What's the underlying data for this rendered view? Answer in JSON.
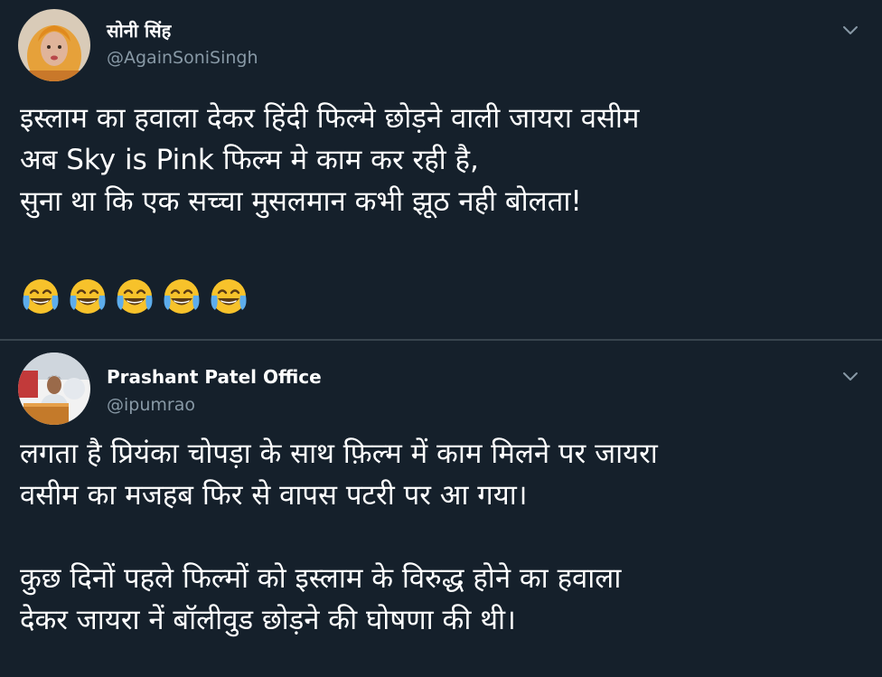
{
  "tweets": [
    {
      "display_name": "सोनी सिंह",
      "handle": "@AgainSoniSingh",
      "avatar": "avatar-woman-orange-scarf",
      "menu_icon": "chevron-down-icon",
      "text_lines": [
        "इस्लाम का हवाला देकर हिंदी फिल्मे छोड़ने वाली जायरा वसीम",
        "अब Sky is Pink फिल्म मे काम कर रही है,",
        "सुना था कि एक सच्चा मुसलमान कभी झूठ नही बोलता!"
      ],
      "emojis": [
        "face-with-tears-of-joy-icon",
        "face-with-tears-of-joy-icon",
        "face-with-tears-of-joy-icon",
        "face-with-tears-of-joy-icon",
        "face-with-tears-of-joy-icon"
      ]
    },
    {
      "display_name": "Prashant Patel Office",
      "handle": "@ipumrao",
      "avatar": "avatar-man-at-podium",
      "menu_icon": "chevron-down-icon",
      "paragraphs": [
        [
          "लगता है प्रियंका चोपड़ा के साथ फ़िल्म में काम मिलने पर जायरा",
          "वसीम का मजहब फिर से वापस पटरी पर आ गया।"
        ],
        [
          "कुछ दिनों पहले फिल्मों को इस्लाम के विरुद्ध होने का हवाला",
          "देकर जायरा नें बॉलीवुड छोड़ने की घोषणा की थी।"
        ]
      ]
    }
  ],
  "colors": {
    "background": "#15202b",
    "divider": "#38444d",
    "primary_text": "#ffffff",
    "secondary_text": "#8899a6",
    "emoji_face": "#f7c22b",
    "emoji_tears": "#5dadec"
  }
}
